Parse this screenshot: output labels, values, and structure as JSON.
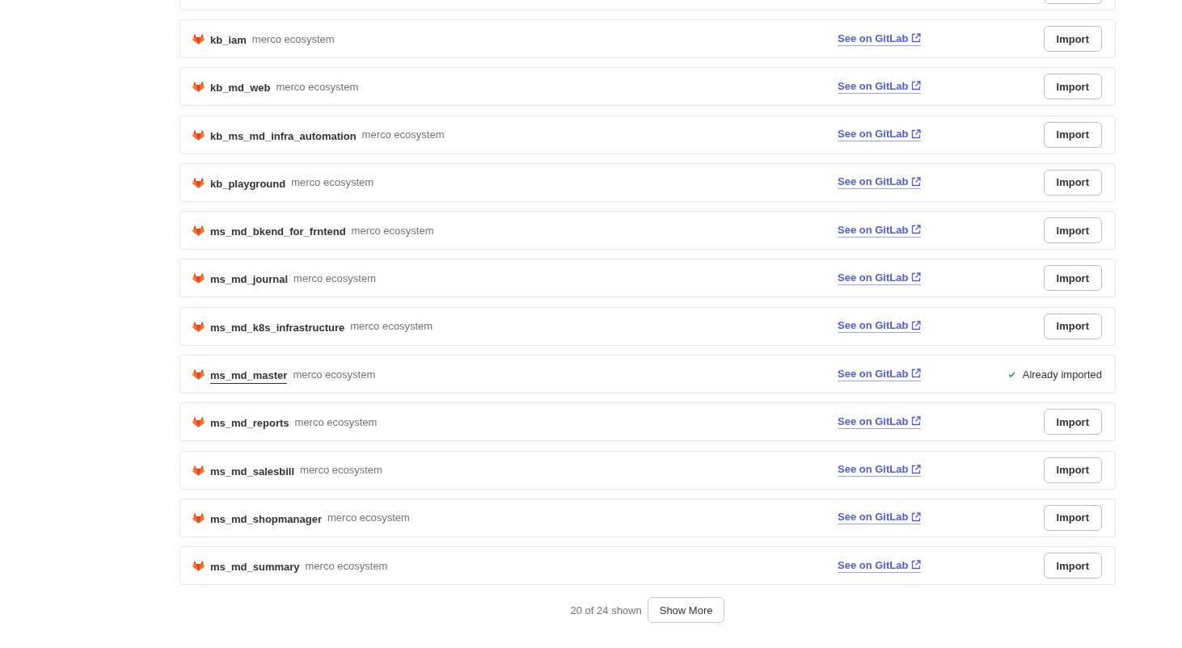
{
  "rows": [
    {
      "name": "kb_iam",
      "namespace": "merco ecosystem",
      "link": "See on GitLab",
      "hovered": false,
      "action": {
        "kind": "button",
        "label": "Import"
      }
    },
    {
      "name": "kb_md_web",
      "namespace": "merco ecosystem",
      "link": "See on GitLab",
      "hovered": false,
      "action": {
        "kind": "button",
        "label": "Import"
      }
    },
    {
      "name": "kb_ms_md_infra_automation",
      "namespace": "merco ecosystem",
      "link": "See on GitLab",
      "hovered": false,
      "action": {
        "kind": "button",
        "label": "Import"
      }
    },
    {
      "name": "kb_playground",
      "namespace": "merco ecosystem",
      "link": "See on GitLab",
      "hovered": false,
      "action": {
        "kind": "button",
        "label": "Import"
      }
    },
    {
      "name": "ms_md_bkend_for_frntend",
      "namespace": "merco ecosystem",
      "link": "See on GitLab",
      "hovered": false,
      "action": {
        "kind": "button",
        "label": "Import"
      }
    },
    {
      "name": "ms_md_journal",
      "namespace": "merco ecosystem",
      "link": "See on GitLab",
      "hovered": false,
      "action": {
        "kind": "button",
        "label": "Import"
      }
    },
    {
      "name": "ms_md_k8s_infrastructure",
      "namespace": "merco ecosystem",
      "link": "See on GitLab",
      "hovered": false,
      "action": {
        "kind": "button",
        "label": "Import"
      }
    },
    {
      "name": "ms_md_master",
      "namespace": "merco ecosystem",
      "link": "See on GitLab",
      "hovered": true,
      "action": {
        "kind": "status",
        "label": "Already imported"
      }
    },
    {
      "name": "ms_md_reports",
      "namespace": "merco ecosystem",
      "link": "See on GitLab",
      "hovered": false,
      "action": {
        "kind": "button",
        "label": "Import"
      }
    },
    {
      "name": "ms_md_salesbill",
      "namespace": "merco ecosystem",
      "link": "See on GitLab",
      "hovered": false,
      "action": {
        "kind": "button",
        "label": "Import"
      }
    },
    {
      "name": "ms_md_shopmanager",
      "namespace": "merco ecosystem",
      "link": "See on GitLab",
      "hovered": false,
      "action": {
        "kind": "button",
        "label": "Import"
      }
    },
    {
      "name": "ms_md_summary",
      "namespace": "merco ecosystem",
      "link": "See on GitLab",
      "hovered": false,
      "action": {
        "kind": "button",
        "label": "Import"
      }
    }
  ],
  "footer": {
    "count": "20 of 24 shown",
    "button": "Show More"
  }
}
